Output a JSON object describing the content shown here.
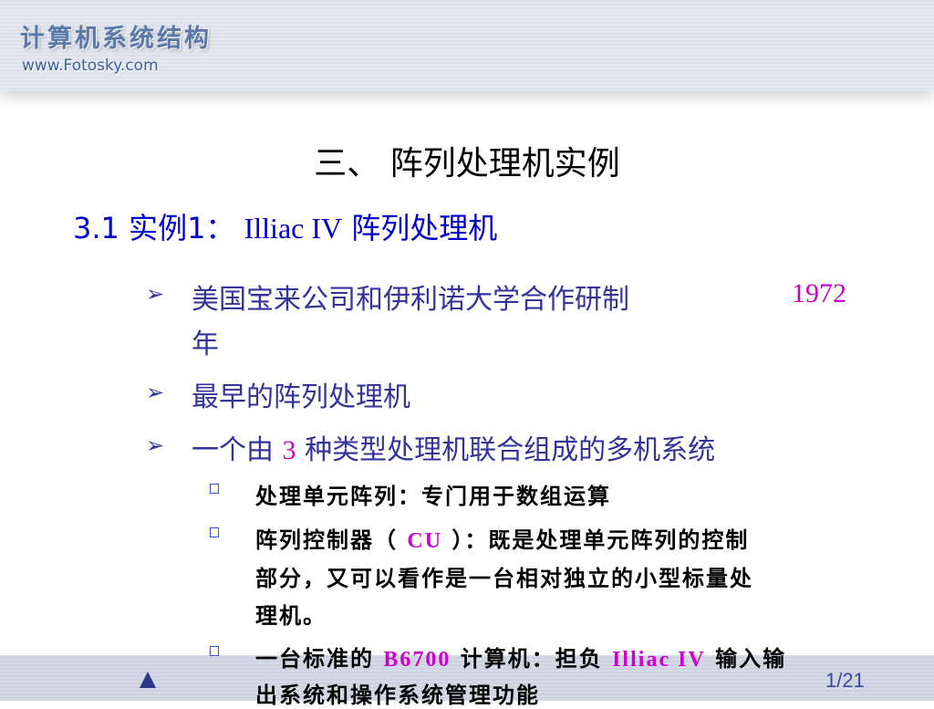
{
  "header": {
    "logo": "计算机系统结构",
    "site": "www.Fotosky.com"
  },
  "slide": {
    "title": "三、  阵列处理机实例",
    "heading": {
      "prefix": "3.1  实例1：",
      "name": "Illiac IV",
      "suffix": "阵列处理机"
    },
    "bullets": [
      {
        "text": "美国宝来公司和伊利诺大学合作研制",
        "year": "1972",
        "cont": "年"
      },
      {
        "text": "最早的阵列处理机"
      },
      {
        "pre": "一个由",
        "num": "3",
        "post": "种类型处理机联合组成的多机系统"
      }
    ],
    "sub_bullets": [
      {
        "text": "处理单元阵列：专门用于数组运算"
      },
      {
        "pre": "阵列控制器（",
        "hl": "CU",
        "post": "）：既是处理单元阵列的控制",
        "line2": "部分，又可以看作是一台相对独立的小型标量处",
        "line3": "理机。"
      },
      {
        "pre": "一台标准的",
        "hl": "B6700",
        "mid": "计算机：担负",
        "hl2": "Illiac IV",
        "post": "输入输",
        "line2": "出系统和操作系统管理功能"
      }
    ]
  },
  "footer": {
    "page": "1/21"
  }
}
